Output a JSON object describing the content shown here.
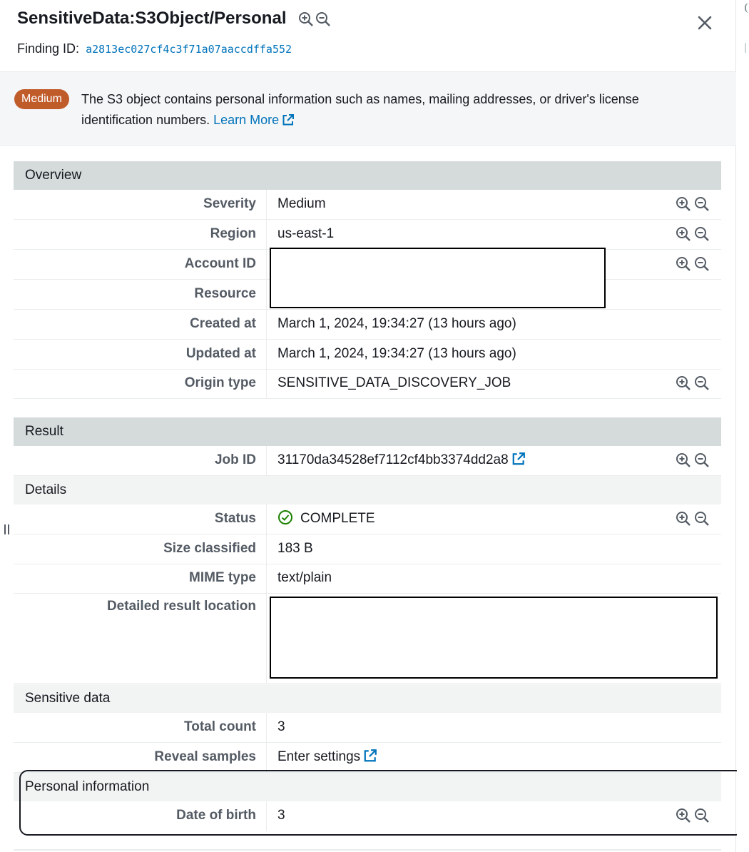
{
  "header": {
    "title": "SensitiveData:S3Object/Personal",
    "finding_label": "Finding ID:",
    "finding_id": "a2813ec027cf4c3f71a07aaccdffa552"
  },
  "banner": {
    "severity_badge": "Medium",
    "description": "The S3 object contains personal information such as names, mailing addresses, or driver's license identification numbers.",
    "learn_more": "Learn More"
  },
  "overview": {
    "heading": "Overview",
    "rows": [
      {
        "label": "Severity",
        "value": "Medium"
      },
      {
        "label": "Region",
        "value": "us-east-1"
      },
      {
        "label": "Account ID",
        "value": ""
      },
      {
        "label": "Resource",
        "value": ""
      },
      {
        "label": "Created at",
        "value": "March 1, 2024, 19:34:27 (13 hours ago)"
      },
      {
        "label": "Updated at",
        "value": "March 1, 2024, 19:34:27 (13 hours ago)"
      },
      {
        "label": "Origin type",
        "value": "SENSITIVE_DATA_DISCOVERY_JOB"
      }
    ]
  },
  "result": {
    "heading": "Result",
    "job_id_label": "Job ID",
    "job_id_value": "31170da34528ef7112cf4bb3374dd2a8"
  },
  "details": {
    "heading": "Details",
    "rows": [
      {
        "label": "Status",
        "value": "COMPLETE"
      },
      {
        "label": "Size classified",
        "value": "183 B"
      },
      {
        "label": "MIME type",
        "value": "text/plain"
      },
      {
        "label": "Detailed result location",
        "value": ""
      }
    ]
  },
  "sensitive_data": {
    "heading": "Sensitive data",
    "total_count_label": "Total count",
    "total_count_value": "3",
    "reveal_label": "Reveal samples",
    "reveal_value": "Enter settings"
  },
  "personal_info": {
    "heading": "Personal information",
    "dob_label": "Date of birth",
    "dob_value": "3"
  },
  "colors": {
    "link": "#0073bb",
    "badge_medium": "#c05b2a",
    "section_header": "#d5dbdb",
    "status_ok": "#1d8102"
  },
  "icons": [
    "zoom-in-icon",
    "zoom-out-icon",
    "close-icon",
    "external-link-icon",
    "check-circle-icon"
  ]
}
